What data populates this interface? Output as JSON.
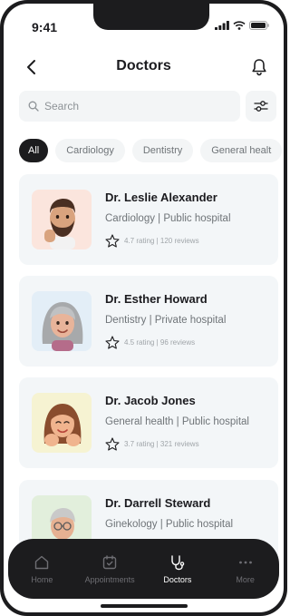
{
  "status_bar": {
    "time": "9:41"
  },
  "header": {
    "title": "Doctors"
  },
  "search": {
    "placeholder": "Search"
  },
  "chips": [
    {
      "label": "All"
    },
    {
      "label": "Cardiology"
    },
    {
      "label": "Dentistry"
    },
    {
      "label": "General healt"
    }
  ],
  "doctors": [
    {
      "name": "Dr. Leslie Alexander",
      "specialty": "Cardiology | Public hospital",
      "rating": "4.7 rating | 120 reviews",
      "avatar_bg": "#fbe5dd"
    },
    {
      "name": "Dr. Esther Howard",
      "specialty": "Dentistry | Private hospital",
      "rating": "4.5 rating | 96 reviews",
      "avatar_bg": "#e3eef7"
    },
    {
      "name": "Dr. Jacob Jones",
      "specialty": "General health | Public hospital",
      "rating": "3.7 rating | 321 reviews",
      "avatar_bg": "#f6f3d2"
    },
    {
      "name": "Dr. Darrell Steward",
      "specialty": "Ginekology | Public hospital",
      "rating": "",
      "avatar_bg": "#e2efdc"
    }
  ],
  "tabbar": {
    "items": [
      {
        "label": "Home",
        "icon": "home-icon"
      },
      {
        "label": "Appointments",
        "icon": "calendar-icon"
      },
      {
        "label": "Doctors",
        "icon": "stethoscope-icon"
      },
      {
        "label": "More",
        "icon": "more-icon"
      }
    ],
    "active": "Doctors"
  },
  "colors": {
    "dark": "#1c1c1e",
    "card": "#f3f6f8",
    "muted": "#6f7478"
  }
}
